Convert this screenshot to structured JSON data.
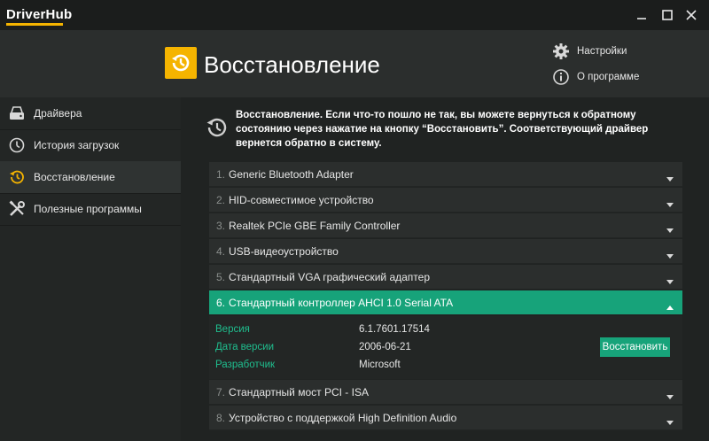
{
  "app": {
    "title": "DriverHub",
    "accent": "#f5b400",
    "green": "#17a37a"
  },
  "window_controls": [
    "minimize-icon",
    "maximize-icon",
    "close-icon"
  ],
  "header": {
    "title": "Восстановление",
    "icon": "restore-clock-icon"
  },
  "top_menu": {
    "settings": {
      "label": "Настройки",
      "icon": "gear-icon"
    },
    "about": {
      "label": "О программе",
      "icon": "info-icon"
    }
  },
  "sidebar": {
    "items": [
      {
        "label": "Драйвера",
        "icon": "drive-icon",
        "active": false
      },
      {
        "label": "История загрузок",
        "icon": "clock-icon",
        "active": false
      },
      {
        "label": "Восстановление",
        "icon": "restore-clock-icon",
        "active": true
      },
      {
        "label": "Полезные программы",
        "icon": "tools-icon",
        "active": false
      }
    ]
  },
  "info": {
    "text": "Восстановление. Если что-то пошло не так, вы можете вернуться к обратному состоянию через нажатие на кнопку “Восстановить”. Соответствующий драйвер вернется обратно в систему."
  },
  "devices": [
    {
      "num": "1.",
      "name": "Generic Bluetooth Adapter"
    },
    {
      "num": "2.",
      "name": "HID-совместимое устройство"
    },
    {
      "num": "3.",
      "name": "Realtek PCIe GBE Family Controller"
    },
    {
      "num": "4.",
      "name": "USB-видеоустройство"
    },
    {
      "num": "5.",
      "name": "Стандартный VGA графический адаптер"
    },
    {
      "num": "6.",
      "name": "Стандартный контроллер AHCI 1.0 Serial ATA",
      "expanded": true
    },
    {
      "num": "7.",
      "name": "Стандартный мост PCI - ISA"
    },
    {
      "num": "8.",
      "name": "Устройство с поддержкой High Definition Audio"
    }
  ],
  "details": {
    "version_label": "Версия",
    "version_value": "6.1.7601.17514",
    "date_label": "Дата версии",
    "date_value": "2006-06-21",
    "developer_label": "Разработчик",
    "developer_value": "Microsoft",
    "restore_button": "Восстановить"
  }
}
